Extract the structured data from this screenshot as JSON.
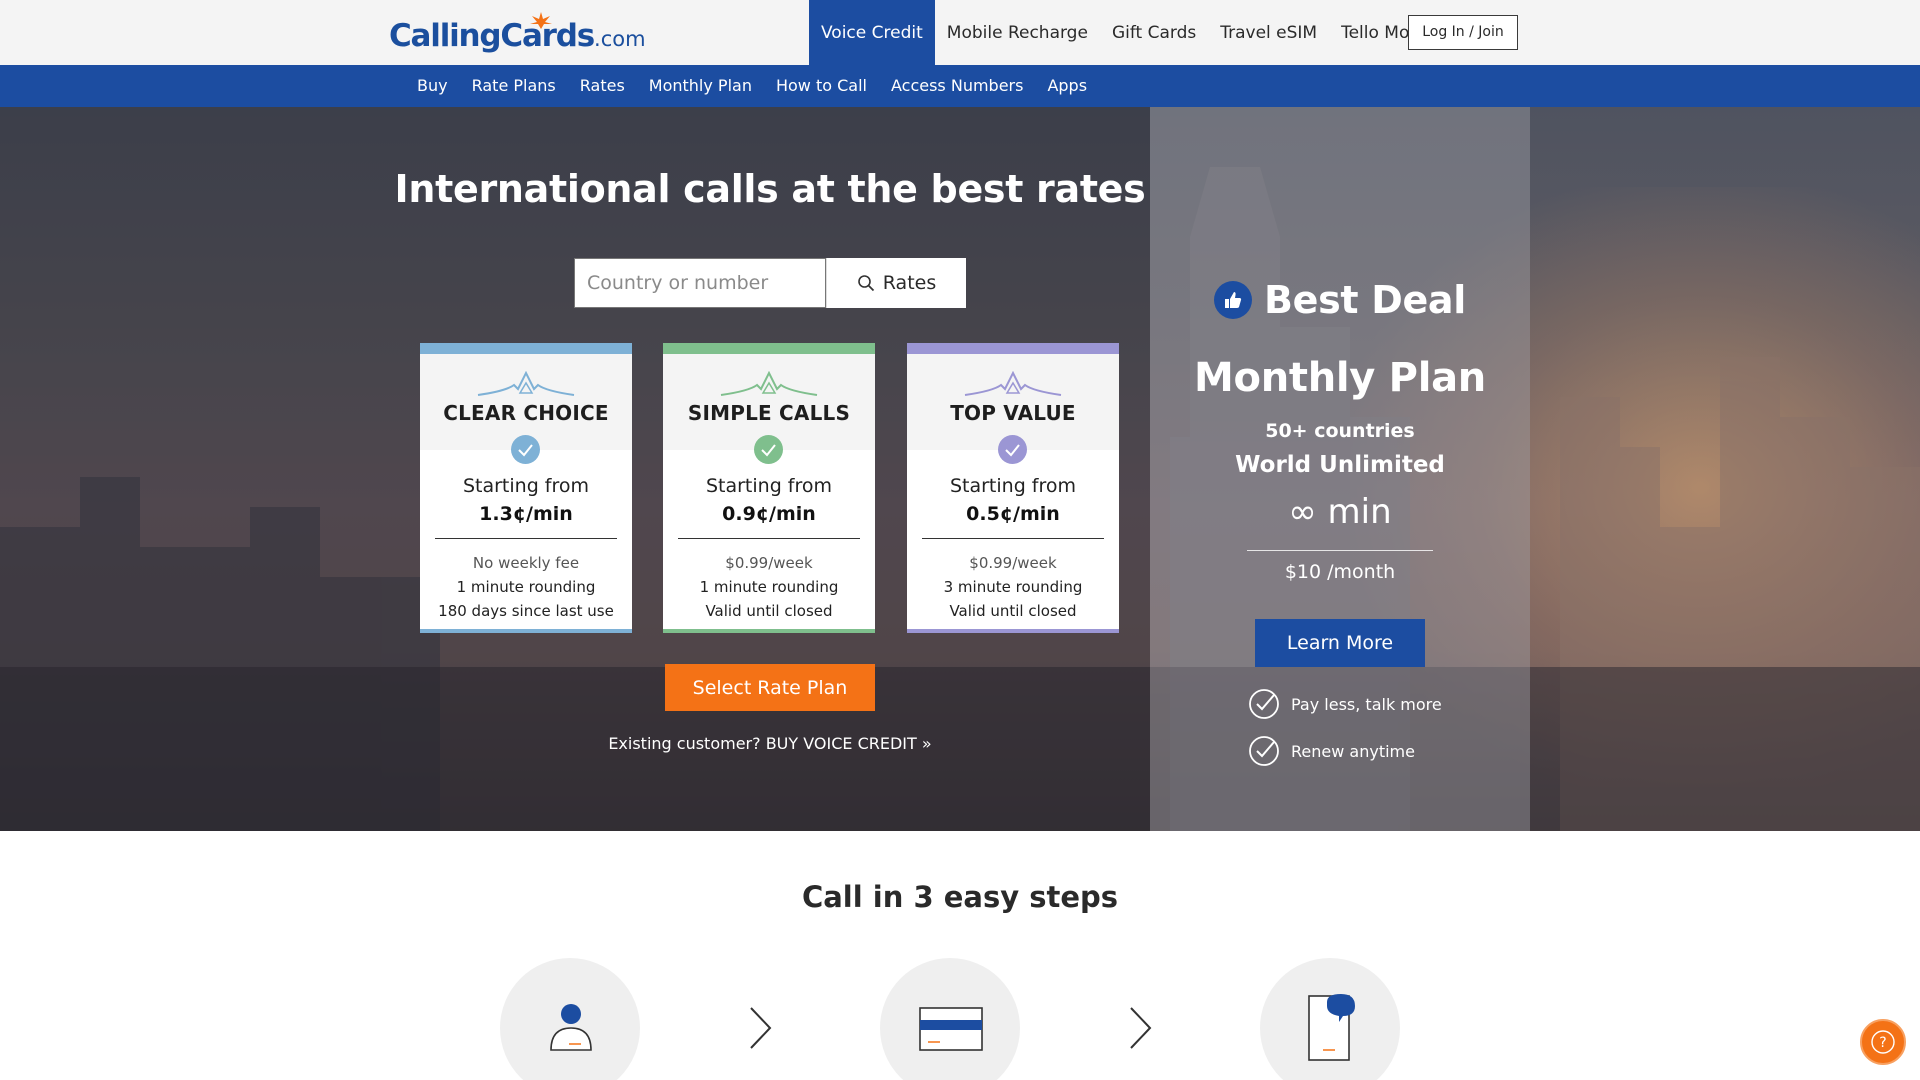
{
  "brand": {
    "logo_text": "CallingCards",
    "logo_domain": ".com",
    "primary_color": "#1c4da1",
    "accent_color": "#f47216"
  },
  "topnav": {
    "items": [
      "Voice Credit",
      "Mobile Recharge",
      "Gift Cards",
      "Travel eSIM",
      "Tello Mobile"
    ],
    "active": "Voice Credit",
    "login_label": "Log In / Join"
  },
  "subnav": {
    "items": [
      "Buy",
      "Rate Plans",
      "Rates",
      "Monthly Plan",
      "How to Call",
      "Access Numbers",
      "Apps"
    ]
  },
  "hero": {
    "title": "International calls at the best rates",
    "search_placeholder": "Country or number",
    "search_button": "Rates",
    "select_button": "Select Rate Plan",
    "existing_customer": "Existing customer? BUY VOICE CREDIT »"
  },
  "plans": [
    {
      "name": "CLEAR CHOICE",
      "start_label": "Starting from",
      "rate": "1.3¢/min",
      "features": [
        "No weekly fee",
        "1 minute rounding",
        "180 days since last use"
      ],
      "color": "#7eb1d6"
    },
    {
      "name": "SIMPLE CALLS",
      "start_label": "Starting from",
      "rate": "0.9¢/min",
      "features": [
        "$0.99/week",
        "1 minute rounding",
        "Valid until closed"
      ],
      "color": "#7fbf8d"
    },
    {
      "name": "TOP VALUE",
      "start_label": "Starting from",
      "rate": "0.5¢/min",
      "features": [
        "$0.99/week",
        "3 minute rounding",
        "Valid until closed"
      ],
      "color": "#9b96d4"
    }
  ],
  "deal": {
    "title": "Best Deal",
    "plan": "Monthly Plan",
    "countries": "50+ countries",
    "unlimited": "World Unlimited",
    "minutes": "∞ min",
    "price": "$10 /month",
    "button": "Learn More",
    "benefits": [
      "Pay less, talk more",
      "Renew anytime"
    ]
  },
  "steps": {
    "title": "Call in 3 easy steps",
    "icons": [
      "user-icon",
      "credit-card-icon",
      "phone-chat-icon"
    ]
  },
  "help": {
    "icon": "help-icon",
    "glyph": "?"
  }
}
